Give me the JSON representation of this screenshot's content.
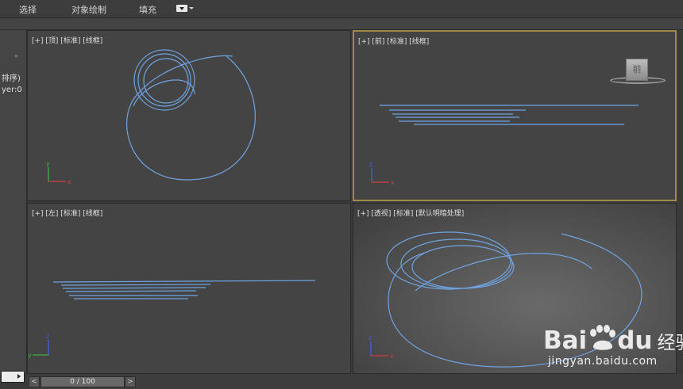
{
  "menu": {
    "select": "选择",
    "draw": "对象绘制",
    "fill": "填充"
  },
  "left_panel": {
    "expand": "»",
    "sort": "排序)",
    "layer": "yer:0"
  },
  "viewports": {
    "top": {
      "label": "[+] [顶] [标准] [线框]"
    },
    "front": {
      "label": "[+] [前] [标准] [线框]",
      "viewcube": "前"
    },
    "left": {
      "label": "[+] [左] [标准] [线框]"
    },
    "perspective": {
      "label": "[+] [透视] [标准] [默认明暗处理]"
    }
  },
  "axes": {
    "x": "x",
    "y": "y",
    "z": "z"
  },
  "timeline": {
    "prev": "<",
    "next": ">",
    "frame": "0 / 100"
  },
  "watermark": {
    "brand_bai": "Bai",
    "brand_du": "du",
    "brand_jy": "经验",
    "url": "jingyan.baidu.com"
  },
  "colors": {
    "curve": "#6fa3e0",
    "active_border": "#a08a48",
    "axis_x": "#d04040",
    "axis_y": "#40b040",
    "axis_z": "#4060e0"
  }
}
